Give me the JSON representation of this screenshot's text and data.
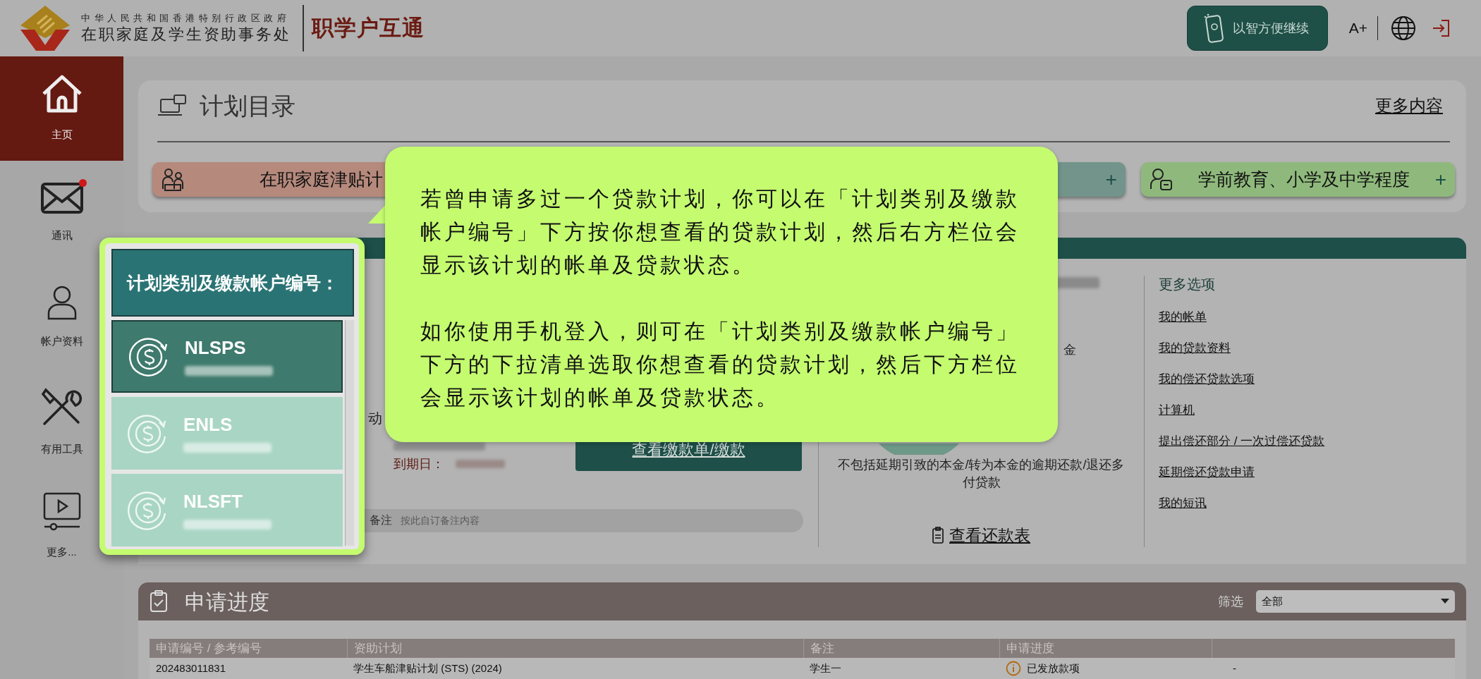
{
  "header": {
    "agency_line1": "中华人民共和国香港特别行政区政府",
    "agency_line2": "在职家庭及学生资助事务处",
    "app_title": "职学户互通",
    "mobile_button": "以智方便继续",
    "font_size_button": "A+"
  },
  "sidebar": {
    "items": [
      {
        "label": "主页",
        "kind": "home",
        "selected": true,
        "unread": false
      },
      {
        "label": "通讯",
        "kind": "mail",
        "selected": false,
        "unread": true
      },
      {
        "label": "帐户资料",
        "kind": "person",
        "selected": false,
        "unread": false
      },
      {
        "label": "有用工具",
        "kind": "tools",
        "selected": false,
        "unread": false
      },
      {
        "label": "更多...",
        "kind": "video",
        "selected": false,
        "unread": false
      }
    ]
  },
  "catalog": {
    "title": "计划目录",
    "more_link": "更多内容",
    "schemes": [
      {
        "label": "在职家庭津贴计",
        "color": "#b5897c",
        "kind": "family"
      },
      {
        "color": "#72948a",
        "expand": "+"
      },
      {
        "label": "学前教育、小学及中学程度",
        "color": "#8fb97c",
        "kind": "student",
        "expand": "+"
      }
    ]
  },
  "loan": {
    "cut_text": "动",
    "due_label": "到期日：",
    "pay_button": "查看缴款单/缴款",
    "note_label": "备注",
    "note_placeholder": "按此自订备注内容",
    "balance_cut_text": "金",
    "balance_note": "不包括延期引致的本金/转为本金的逾期还款/退还多付贷款",
    "schedule_link": "查看还款表",
    "more_title": "更多选项",
    "more_links": [
      "我的帐单",
      "我的贷款资料",
      "我的偿还贷款选项",
      "计算机",
      "提出偿还部分 / 一次过偿还贷款",
      "延期偿还贷款申请",
      "我的短讯"
    ]
  },
  "applications": {
    "title": "申请进度",
    "filter_label": "筛选",
    "filter_value": "全部",
    "columns": [
      "申请编号 / 参考编号",
      "资助计划",
      "备注",
      "申请进度"
    ],
    "rows": [
      {
        "cells": [
          "202483011831",
          "学生车船津贴计划 (STS) (2024)",
          "学生一",
          "已发放款项",
          "-"
        ]
      }
    ]
  },
  "account_popup": {
    "title": "计划类别及缴款帐户编号：",
    "accounts": [
      {
        "code": "NLSPS",
        "selected": true
      },
      {
        "code": "ENLS",
        "selected": false
      },
      {
        "code": "NLSFT",
        "selected": false
      }
    ]
  },
  "tooltip": {
    "paragraphs": [
      "若曾申请多过一个贷款计划，你可以在「计划类别及缴款帐户编号」下方按你想查看的贷款计划，然后右方栏位会显示该计划的帐单及贷款状态。",
      "如你使用手机登入，则可在「计划类别及缴款帐户编号」下方的下拉清单选取你想查看的贷款计划，然后下方栏位会显示该计划的帐单及贷款状态。"
    ]
  }
}
